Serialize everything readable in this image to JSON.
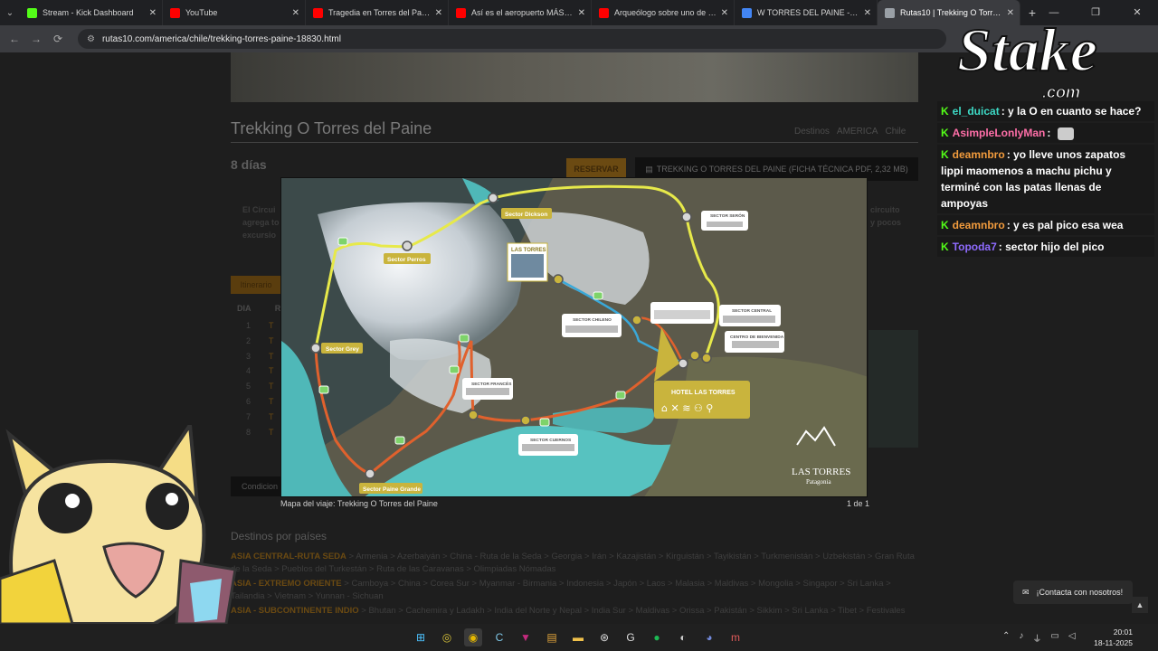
{
  "browser": {
    "tabs": [
      {
        "title": "Stream - Kick Dashboard",
        "fav_color": "#53fc18",
        "active": false
      },
      {
        "title": "YouTube",
        "fav_color": "#ff0000",
        "active": false
      },
      {
        "title": "Tragedia en Torres del Paine: Ra",
        "fav_color": "#ff0000",
        "active": false
      },
      {
        "title": "Así es el aeropuerto MÁS MOD",
        "fav_color": "#ff0000",
        "active": false
      },
      {
        "title": "Arqueólogo sobre uno de los m",
        "fav_color": "#ff0000",
        "active": false
      },
      {
        "title": "W TORRES DEL PAINE - Buscar",
        "fav_color": "#4285f4",
        "active": false
      },
      {
        "title": "Rutas10 | Trekking O Torres de",
        "fav_color": "#9aa0a6",
        "active": true
      }
    ],
    "new_tab": "+",
    "url": "rutas10.com/america/chile/trekking-torres-paine-18830.html"
  },
  "page": {
    "title": "Trekking O Torres del Paine",
    "breadcrumbs": [
      "Destinos",
      "AMERICA",
      "Chile"
    ],
    "duration": "8 días",
    "reserve_label": "RESERVAR",
    "pdf_label": "TREKKING O TORRES DEL PAINE (FICHA TÉCNICA PDF, 2,32 MB)",
    "intro_left": "El Circui",
    "intro_left2": "agrega to",
    "intro_left3": "excursio",
    "intro_right": "circuito",
    "intro_right2": "y pocos",
    "itinerary_tab": "Itinerario",
    "itinerary_head": "DIA",
    "itinerary_head2": "R",
    "days": [
      "1",
      "2",
      "3",
      "4",
      "5",
      "6",
      "7",
      "8"
    ],
    "day_rows_prefix": "T",
    "conditions_tab": "Condicion",
    "destinations_title": "Destinos por países",
    "destinations": [
      {
        "region": "ASIA CENTRAL-RUTA SEDA",
        "items": "> Armenia > Azerbaiyán > China - Ruta de la Seda > Georgia > Irán > Kazajistán > Kirguistán > Tayikistán > Turkmenistán > Uzbekistán > Gran Ruta de la Seda > Pueblos del Turkestán > Ruta de las Caravanas > Olimpiadas Nómadas"
      },
      {
        "region": "ASIA - EXTREMO ORIENTE",
        "items": "> Camboya > China > Corea Sur > Myanmar - Birmania > Indonesia > Japón > Laos > Malasia > Maldivas > Mongolia > Singapor > Sri Lanka > Tailandia > Vietnam > Yunnan - Sichuan"
      },
      {
        "region": "ASIA - SUBCONTINENTE INDIO",
        "items": "> Bhutan > Cachemira y Ladakh > India del Norte y Nepal > India Sur > Maldivas > Orissa > Pakistán > Sikkim > Sri Lanka > Tibet > Festivales"
      }
    ]
  },
  "lightbox": {
    "caption": "Mapa del viaje: Trekking O Torres del Paine",
    "counter": "1 de 1",
    "map": {
      "labels": {
        "dickson": "Sector Dickson",
        "perros": "Sector Perros",
        "grey": "Sector Grey",
        "paine_grande": "Sector Paine Grande",
        "las_torres": "LAS TORRES",
        "seron": "SECTOR SERÓN",
        "chileno": "SECTOR CHILENO",
        "central": "SECTOR CENTRAL",
        "bienvenida": "CENTRO DE BIENVENIDA",
        "frances": "SECTOR FRANCÉS",
        "cuernos": "SECTOR CUERNOS",
        "hotel": "HOTEL LAS TORRES",
        "brand": "LAS TORRES",
        "brand_sub": "Patagonia"
      },
      "colors": {
        "o_route": "#e7e94a",
        "w_route": "#e0612d",
        "access": "#3aa8d8",
        "badge": "#c9b43d"
      }
    }
  },
  "contact": {
    "label": "¡Contacta con nosotros!"
  },
  "stream": {
    "logo": "Stake",
    "logo_sub": ".com",
    "chat": [
      {
        "user": "el_duicat",
        "user_color": "#3dd9c5",
        "text": "y la O en cuanto se hace?"
      },
      {
        "user": "AsimpleLonlyMan",
        "user_color": "#ff6fa8",
        "text": ""
      },
      {
        "user": "deamnbro",
        "user_color": "#f39c3d",
        "text": "yo lleve unos zapatos lippi maomenos a machu pichu y terminé con las patas llenas de ampoyas"
      },
      {
        "user": "deamnbro",
        "user_color": "#f39c3d",
        "text": "y es pal pico esa wea"
      },
      {
        "user": "Topoda7",
        "user_color": "#8f6bff",
        "text": "sector hijo del pico"
      }
    ]
  },
  "taskbar": {
    "time": "20:01",
    "date": "18-11-2025"
  }
}
